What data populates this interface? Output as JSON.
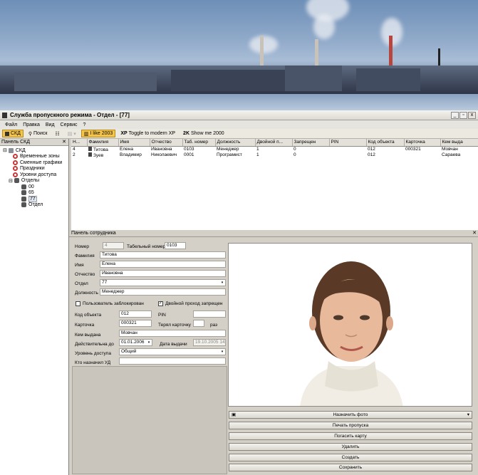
{
  "window": {
    "title": "Служба пропускного режима - Отдел - [77]",
    "buttons": [
      "_",
      "▫",
      "x"
    ]
  },
  "menu": [
    "Файл",
    "Правка",
    "Вид",
    "Сервис",
    "?"
  ],
  "toolbar": {
    "skd": "СКД",
    "search": "Поиск",
    "like2003": "I like 2003",
    "xp": "Toggle to modern XP",
    "w2k": "Show me 2000",
    "xp_tag": "XP",
    "k_tag": "2K"
  },
  "left_panel": {
    "title": "Панель СКД",
    "close": "✕",
    "tree": [
      {
        "label": "СКД",
        "level": 0,
        "icon": "pc-icon",
        "toggle": "⊟"
      },
      {
        "label": "Временные зоны",
        "level": 1,
        "icon": "clock-icon"
      },
      {
        "label": "Сменные графики",
        "level": 1,
        "icon": "clock-icon"
      },
      {
        "label": "Праздники",
        "level": 1,
        "icon": "clock-icon"
      },
      {
        "label": "Уровни доступа",
        "level": 1,
        "icon": "clock-icon"
      },
      {
        "label": "Отделы",
        "level": 1,
        "icon": "people-icon",
        "toggle": "⊟"
      },
      {
        "label": "00",
        "level": 2,
        "icon": "person-icon"
      },
      {
        "label": "65",
        "level": 2,
        "icon": "person-icon"
      },
      {
        "label": "77",
        "level": 2,
        "icon": "person-icon",
        "selected": true
      },
      {
        "label": "Отдел",
        "level": 2,
        "icon": "person-icon"
      }
    ]
  },
  "grid": {
    "columns": [
      "Н...",
      "Фамилия",
      "Имя",
      "Отчество",
      "Таб. номер",
      "Должность",
      "Двойной п...",
      "Запрещен",
      "PIN",
      "Код объекта",
      "Карточка",
      "Кем выда"
    ],
    "rows": [
      [
        "4",
        "Титова",
        "Елена",
        "Ивановна",
        "0103",
        "Менеджер",
        "1",
        "0",
        "",
        "012",
        "000321",
        "Мовчан"
      ],
      [
        "2",
        "Зуев",
        "Владимир",
        "Николаевич",
        "0001",
        "Програмист",
        "1",
        "0",
        "",
        "012",
        "",
        "Сараева"
      ]
    ]
  },
  "employee_panel": {
    "title": "Панель сотрудника",
    "close": "✕",
    "labels": {
      "number": "Номер",
      "tab_number": "Табельный номер",
      "surname": "Фамилия",
      "name": "Имя",
      "patronymic": "Отчество",
      "department": "Отдел",
      "position": "Должность",
      "blocked": "Пользователь заблокирован",
      "double_pass": "Двойной проход запрещен",
      "object_code": "Код объекта",
      "pin": "PIN",
      "card": "Карточка",
      "lost_card": "Терял карточку",
      "times": "раз",
      "issued_by": "Кем выдана",
      "valid_until": "Действительна до",
      "issue_date": "Дата выдачи",
      "access_level": "Уровень доступа",
      "assigned_by": "Кто назначил УД"
    },
    "values": {
      "number": "4",
      "tab_number": "0103",
      "surname": "Титова",
      "name": "Елена",
      "patronymic": "Ивановна",
      "department": "77",
      "position": "Менеджер",
      "object_code": "012",
      "pin": "",
      "card": "000321",
      "lost_card": "",
      "issued_by": "Мовчан",
      "valid_until": "01.01.2006",
      "issue_date": "19.10.2005 14:07",
      "access_level": "Общий",
      "assigned_by": "",
      "blocked": false,
      "double_pass": true
    },
    "buttons": {
      "assign_photo": "Назначить фото",
      "print_pass": "Печать пропуска",
      "cancel_card": "Погасить карту",
      "delete": "Удалить",
      "create": "Создать",
      "save": "Сохранить"
    }
  }
}
